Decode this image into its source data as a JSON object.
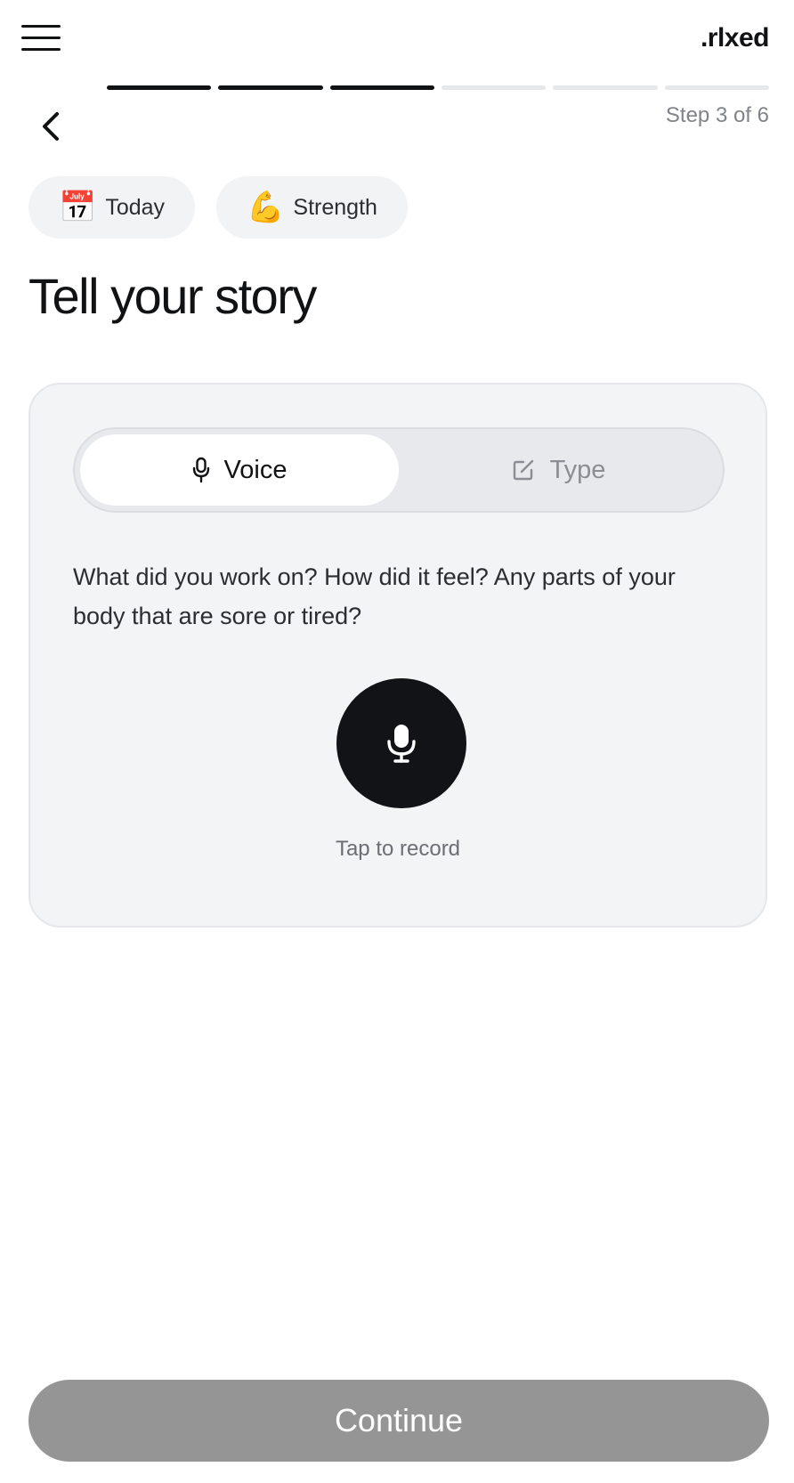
{
  "header": {
    "brand": ".rlxed",
    "menu_icon": "hamburger-menu-icon"
  },
  "progress": {
    "current_step": 3,
    "total_steps": 6,
    "label": "Step 3 of 6"
  },
  "navigation": {
    "back_icon": "chevron-left-icon"
  },
  "chips": [
    {
      "emoji": "📅",
      "icon": "calendar-icon",
      "label": "Today"
    },
    {
      "emoji": "💪",
      "icon": "flexed-biceps-icon",
      "label": "Strength"
    }
  ],
  "title": "Tell your story",
  "input_mode": {
    "selected": "Voice",
    "options": [
      {
        "label": "Voice",
        "icon": "microphone-icon"
      },
      {
        "label": "Type",
        "icon": "edit-icon"
      }
    ]
  },
  "prompt": "What did you work on?  How did it feel?  Any parts of your body that are sore or tired?",
  "record": {
    "icon": "microphone-icon",
    "label": "Tap to record"
  },
  "continue_label": "Continue",
  "colors": {
    "primary": "#121316",
    "continue_disabled": "#959595",
    "card_background": "#f3f4f6",
    "progress_inactive": "#e6e7ea"
  }
}
